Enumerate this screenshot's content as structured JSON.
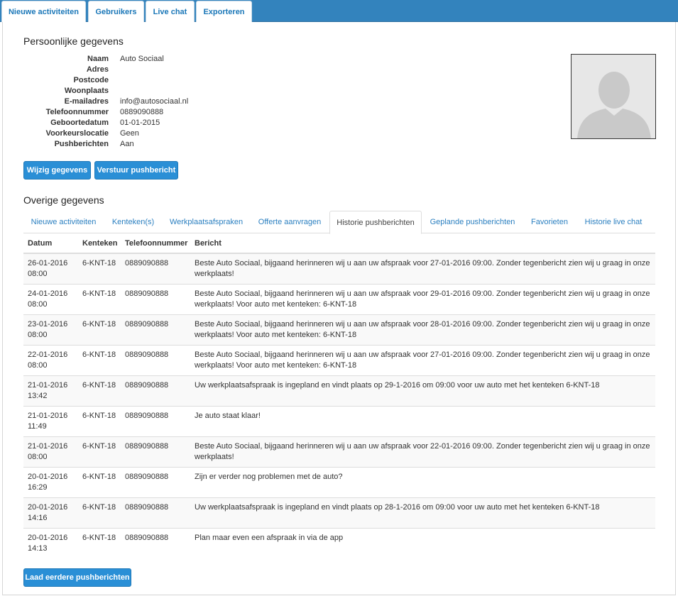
{
  "top_tabs": [
    "Nieuwe activiteiten",
    "Gebruikers",
    "Live chat",
    "Exporteren"
  ],
  "personal": {
    "title": "Persoonlijke gegevens",
    "fields": [
      {
        "label": "Naam",
        "value": "Auto Sociaal"
      },
      {
        "label": "Adres",
        "value": ""
      },
      {
        "label": "Postcode",
        "value": ""
      },
      {
        "label": "Woonplaats",
        "value": ""
      },
      {
        "label": "E-mailadres",
        "value": "info@autosociaal.nl"
      },
      {
        "label": "Telefoonnummer",
        "value": "0889090888"
      },
      {
        "label": "Geboortedatum",
        "value": "01-01-2015"
      },
      {
        "label": "Voorkeurslocatie",
        "value": "Geen"
      },
      {
        "label": "Pushberichten",
        "value": "Aan"
      }
    ]
  },
  "buttons": {
    "edit": "Wijzig gegevens",
    "push": "Verstuur pushbericht",
    "load_more": "Laad eerdere pushberichten"
  },
  "other": {
    "title": "Overige gegevens",
    "tabs": [
      "Nieuwe activiteiten",
      "Kenteken(s)",
      "Werkplaatsafspraken",
      "Offerte aanvragen",
      "Historie pushberichten",
      "Geplande pushberichten",
      "Favorieten",
      "Historie live chat"
    ],
    "active_tab": "Historie pushberichten"
  },
  "table": {
    "headers": [
      "Datum",
      "Kenteken",
      "Telefoonnummer",
      "Bericht"
    ],
    "rows": [
      {
        "date": "26-01-2016",
        "time": "08:00",
        "plate": "6-KNT-18",
        "phone": "0889090888",
        "message": "Beste Auto Sociaal, bijgaand herinneren wij u aan uw afspraak voor 27-01-2016 09:00. Zonder tegenbericht zien wij u graag in onze werkplaats!"
      },
      {
        "date": "24-01-2016",
        "time": "08:00",
        "plate": "6-KNT-18",
        "phone": "0889090888",
        "message": "Beste Auto Sociaal, bijgaand herinneren wij u aan uw afspraak voor 29-01-2016 09:00. Zonder tegenbericht zien wij u graag in onze werkplaats! Voor auto met kenteken: 6-KNT-18"
      },
      {
        "date": "23-01-2016",
        "time": "08:00",
        "plate": "6-KNT-18",
        "phone": "0889090888",
        "message": "Beste Auto Sociaal, bijgaand herinneren wij u aan uw afspraak voor 28-01-2016 09:00. Zonder tegenbericht zien wij u graag in onze werkplaats! Voor auto met kenteken: 6-KNT-18"
      },
      {
        "date": "22-01-2016",
        "time": "08:00",
        "plate": "6-KNT-18",
        "phone": "0889090888",
        "message": "Beste Auto Sociaal, bijgaand herinneren wij u aan uw afspraak voor 27-01-2016 09:00. Zonder tegenbericht zien wij u graag in onze werkplaats! Voor auto met kenteken: 6-KNT-18"
      },
      {
        "date": "21-01-2016",
        "time": "13:42",
        "plate": "6-KNT-18",
        "phone": "0889090888",
        "message": "Uw werkplaatsafspraak is ingepland en vindt plaats op 29-1-2016 om 09:00 voor uw auto met het kenteken 6-KNT-18"
      },
      {
        "date": "21-01-2016",
        "time": "11:49",
        "plate": "6-KNT-18",
        "phone": "0889090888",
        "message": "Je auto staat klaar!"
      },
      {
        "date": "21-01-2016",
        "time": "08:00",
        "plate": "6-KNT-18",
        "phone": "0889090888",
        "message": "Beste Auto Sociaal, bijgaand herinneren wij u aan uw afspraak voor 22-01-2016 09:00. Zonder tegenbericht zien wij u graag in onze werkplaats!"
      },
      {
        "date": "20-01-2016",
        "time": "16:29",
        "plate": "6-KNT-18",
        "phone": "0889090888",
        "message": "Zijn er verder nog problemen met de auto?"
      },
      {
        "date": "20-01-2016",
        "time": "14:16",
        "plate": "6-KNT-18",
        "phone": "0889090888",
        "message": "Uw werkplaatsafspraak is ingepland en vindt plaats op 28-1-2016 om 09:00 voor uw auto met het kenteken 6-KNT-18"
      },
      {
        "date": "20-01-2016",
        "time": "14:13",
        "plate": "6-KNT-18",
        "phone": "0889090888",
        "message": "Plan maar even een afspraak in via de app"
      }
    ]
  }
}
